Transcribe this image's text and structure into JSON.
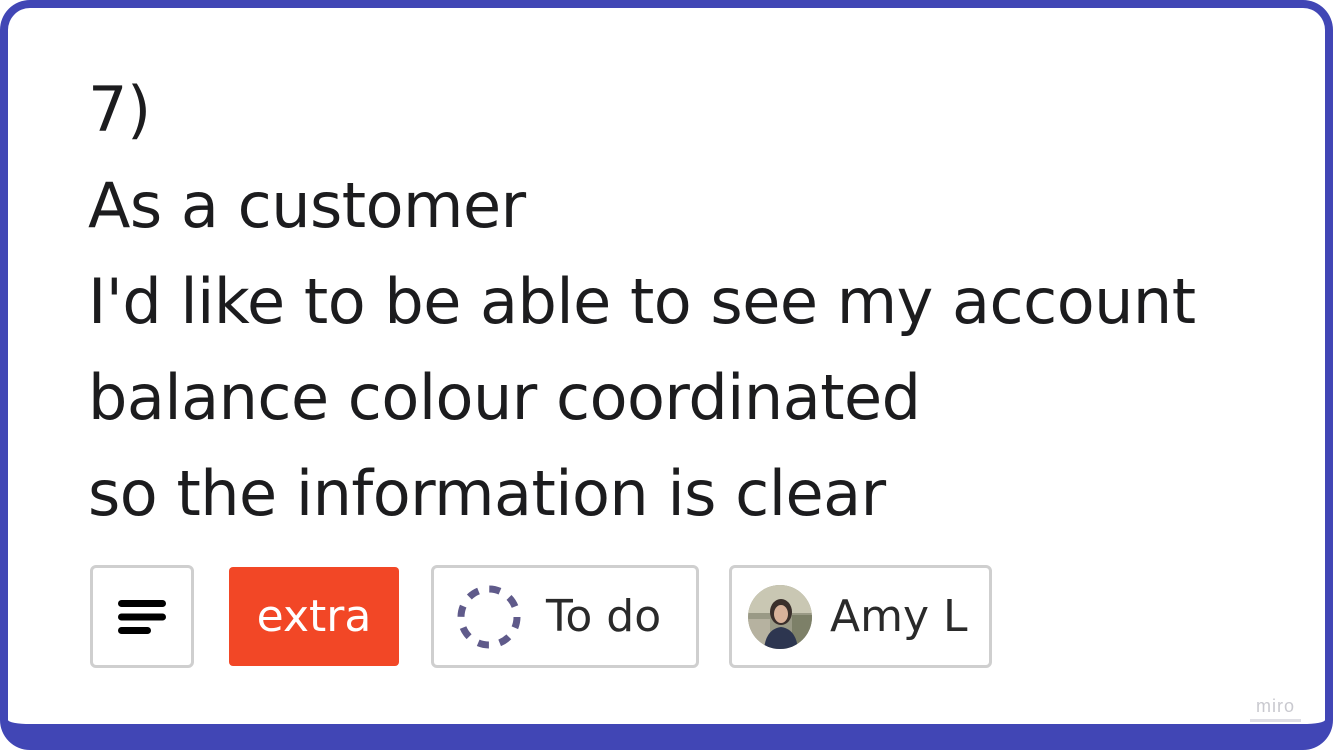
{
  "card": {
    "lines": [
      "7)",
      "As a customer",
      "I'd like to be able to see my account",
      "balance colour coordinated",
      "so the information is clear"
    ],
    "border_color": "#4146b5"
  },
  "chips": {
    "description_icon": "text-lines-icon",
    "tag": {
      "label": "extra",
      "color": "#f24726"
    },
    "status": {
      "label": "To do",
      "icon": "dashed-circle-icon",
      "icon_color": "#5f5a8a"
    },
    "assignee": {
      "name": "Amy L",
      "icon": "avatar"
    }
  },
  "watermark": "miro"
}
